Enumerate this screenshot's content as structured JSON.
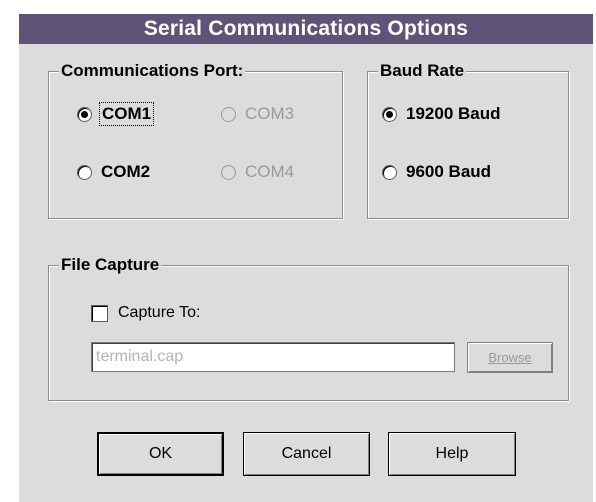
{
  "window": {
    "title": "Serial Communications Options"
  },
  "port_group": {
    "label": "Communications Port:",
    "options": [
      {
        "label": "COM1",
        "selected": true,
        "enabled": true
      },
      {
        "label": "COM2",
        "selected": false,
        "enabled": true
      },
      {
        "label": "COM3",
        "selected": false,
        "enabled": false
      },
      {
        "label": "COM4",
        "selected": false,
        "enabled": false
      }
    ]
  },
  "baud_group": {
    "label": "Baud Rate",
    "options": [
      {
        "label": "19200 Baud",
        "selected": true
      },
      {
        "label": "9600 Baud",
        "selected": false
      }
    ]
  },
  "capture_group": {
    "label": "File Capture",
    "checkbox_label": "Capture To:",
    "checked": false,
    "filename": "terminal.cap",
    "browse_label": "Browse"
  },
  "buttons": {
    "ok": "OK",
    "cancel": "Cancel",
    "help": "Help"
  },
  "colors": {
    "titlebar": "#5d5478",
    "face": "#dcdcdc",
    "disabled_text": "#9a9a9a"
  }
}
